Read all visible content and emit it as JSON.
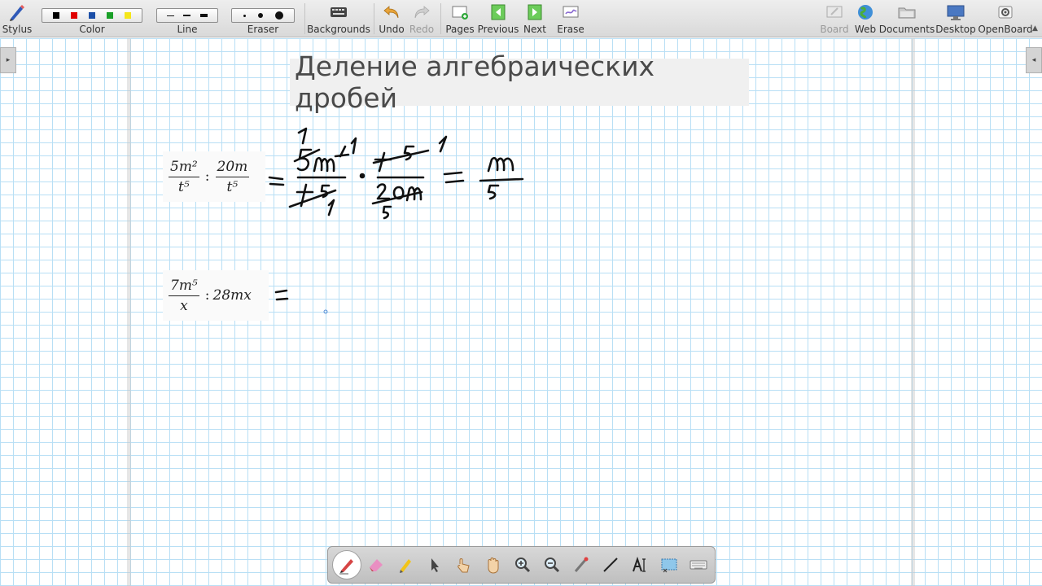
{
  "toolbar": {
    "stylus_label": "Stylus",
    "color_label": "Color",
    "line_label": "Line",
    "eraser_label": "Eraser",
    "backgrounds_label": "Backgrounds",
    "undo_label": "Undo",
    "redo_label": "Redo",
    "pages_label": "Pages",
    "previous_label": "Previous",
    "next_label": "Next",
    "erase_label": "Erase",
    "board_label": "Board",
    "web_label": "Web",
    "documents_label": "Documents",
    "desktop_label": "Desktop",
    "openboard_label": "OpenBoard",
    "palette_colors": [
      "#000000",
      "#e00000",
      "#1c4fa8",
      "#1aa028",
      "#f5e61a"
    ],
    "disabled_color": "#9a9a9a"
  },
  "board": {
    "title": "Деление алгебраических дробей",
    "grid_color": "#b8dff5",
    "expression1": {
      "frac1_num": "5m²",
      "frac1_den": "t⁵",
      "op": ":",
      "frac2_num": "20m",
      "frac2_den": "t⁵"
    },
    "expression2": {
      "frac_num": "7m⁵",
      "frac_den": "x",
      "op": ":",
      "term": "28mx"
    },
    "ink_color": "#111111"
  },
  "dock": {
    "tools": [
      "pen-icon",
      "eraser-icon",
      "highlighter-icon",
      "pointer-icon",
      "play-icon",
      "hand-icon",
      "zoom-in-icon",
      "zoom-out-icon",
      "laser-icon",
      "line-icon",
      "text-icon",
      "capture-icon",
      "keyboard-icon"
    ]
  }
}
